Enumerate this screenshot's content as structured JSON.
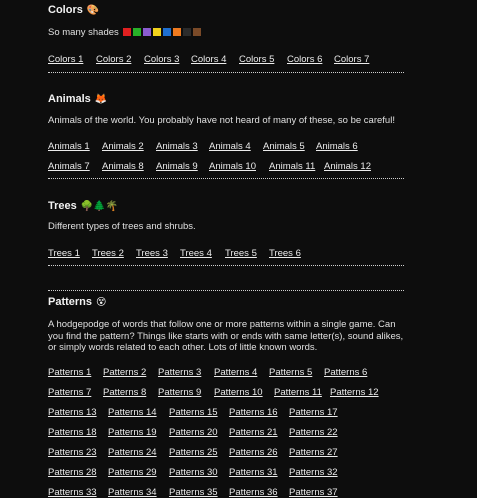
{
  "colors": {
    "title": "Colors",
    "emoji": "🎨",
    "description": "So many shades",
    "swatches": [
      "#e02020",
      "#28b028",
      "#8a5cd0",
      "#f2d21c",
      "#1e6fd0",
      "#ef7a1e",
      "#2b2b2b",
      "#7a4a28"
    ],
    "links": [
      "Colors 1",
      "Colors 2",
      "Colors 3",
      "Colors 4",
      "Colors 5",
      "Colors 6",
      "Colors 7"
    ]
  },
  "animals": {
    "title": "Animals",
    "emoji": "🦊",
    "description": "Animals of the world. You probably have not heard of many of these, so be careful!",
    "links": [
      "Animals 1",
      "Animals 2",
      "Animals 3",
      "Animals 4",
      "Animals 5",
      "Animals 6",
      "Animals 7",
      "Animals 8",
      "Animals 9",
      "Animals 10",
      "Animals 11",
      "Animals 12"
    ]
  },
  "trees": {
    "title": "Trees",
    "emoji": "🌳🌲🌴",
    "description": "Different types of trees and shrubs.",
    "links": [
      "Trees 1",
      "Trees 2",
      "Trees 3",
      "Trees 4",
      "Trees 5",
      "Trees 6"
    ]
  },
  "patterns": {
    "title": "Patterns",
    "emoji": "😵",
    "description": "A hodgepodge of words that follow one or more patterns within a single game. Can you find the pattern? Things like starts with or ends with same letter(s), sound alikes, or simply words related to each other. Lots of little known words.",
    "links_row1": [
      "Patterns 1",
      "Patterns 2",
      "Patterns 3",
      "Patterns 4",
      "Patterns 5",
      "Patterns 6"
    ],
    "links_row2": [
      "Patterns 7",
      "Patterns 8",
      "Patterns 9",
      "Patterns 10",
      "Patterns 11",
      "Patterns 12"
    ],
    "links_grid": [
      [
        "Patterns 13",
        "Patterns 14",
        "Patterns 15",
        "Patterns 16",
        "Patterns 17"
      ],
      [
        "Patterns 18",
        "Patterns 19",
        "Patterns 20",
        "Patterns 21",
        "Patterns 22"
      ],
      [
        "Patterns 23",
        "Patterns 24",
        "Patterns 25",
        "Patterns 26",
        "Patterns 27"
      ],
      [
        "Patterns 28",
        "Patterns 29",
        "Patterns 30",
        "Patterns 31",
        "Patterns 32"
      ],
      [
        "Patterns 33",
        "Patterns 34",
        "Patterns 35",
        "Patterns 36",
        "Patterns 37"
      ]
    ]
  }
}
